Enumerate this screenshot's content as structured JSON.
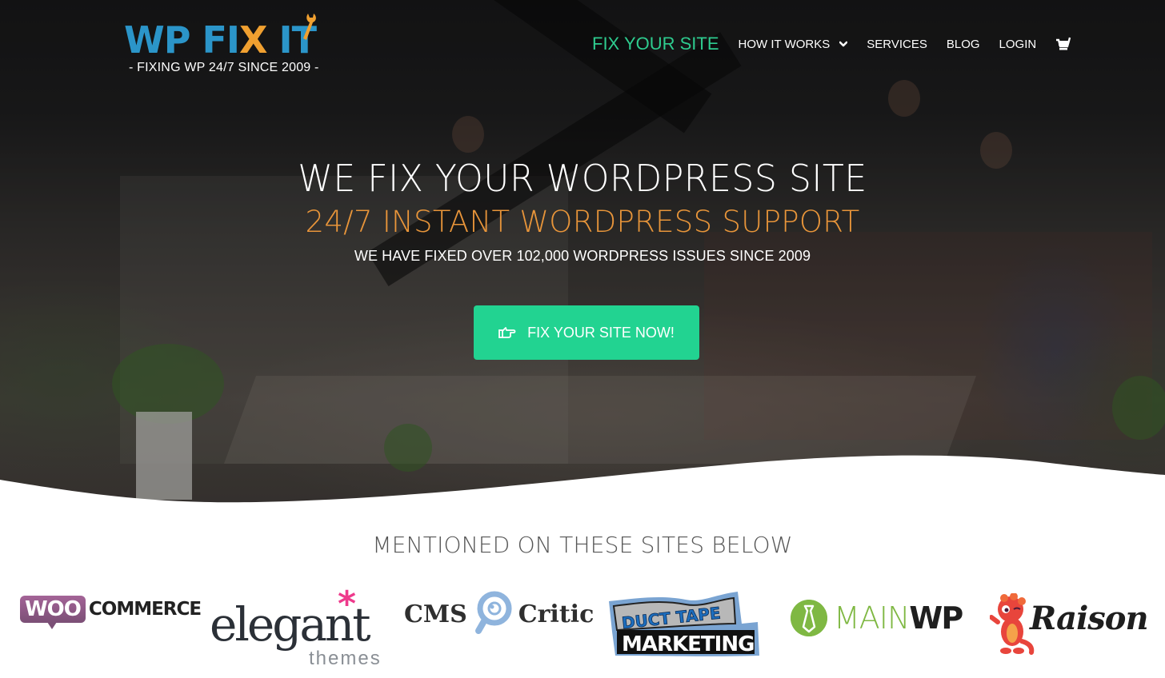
{
  "header": {
    "logo": {
      "title_prefix": "WP FI",
      "title_x": "X",
      "title_suffix": " IT",
      "tagline": "- FIXING WP 24/7 SINCE 2009 -"
    },
    "nav": {
      "primary": "FIX YOUR SITE",
      "items": [
        {
          "label": "HOW IT WORKS",
          "has_dropdown": true
        },
        {
          "label": "SERVICES"
        },
        {
          "label": "BLOG"
        },
        {
          "label": "LOGIN"
        }
      ],
      "cart_icon": "cart-icon"
    }
  },
  "hero": {
    "headline": "WE FIX YOUR WORDPRESS SITE",
    "subheadline": "24/7 INSTANT WORDPRESS SUPPORT",
    "tagline": "WE HAVE FIXED OVER 102,000 WORDPRESS ISSUES SINCE 2009",
    "cta": {
      "label": "FIX YOUR SITE NOW!",
      "icon": "hand-pointing-right-icon"
    }
  },
  "mentions": {
    "title": "MENTIONED ON THESE SITES BELOW",
    "logos": [
      {
        "name": "WooCommerce",
        "part1": "WOO",
        "part2": "COMMERCE"
      },
      {
        "name": "Elegant Themes",
        "part1": "elegant",
        "part2": "themes",
        "mark": "*"
      },
      {
        "name": "CMS Critic",
        "part1": "CMS",
        "part2": "Critic"
      },
      {
        "name": "Duct Tape Marketing",
        "part1": "DUCT TAPE",
        "part2": "MARKETING"
      },
      {
        "name": "MainWP",
        "part1": "MAIN",
        "part2": "WP"
      },
      {
        "name": "Raison",
        "part1": "Raison"
      }
    ]
  },
  "colors": {
    "brand_blue": "#2b95c9",
    "brand_orange": "#f0a030",
    "nav_accent": "#2ecc8f",
    "cta": "#22d391",
    "subheadline": "#e8953a"
  }
}
